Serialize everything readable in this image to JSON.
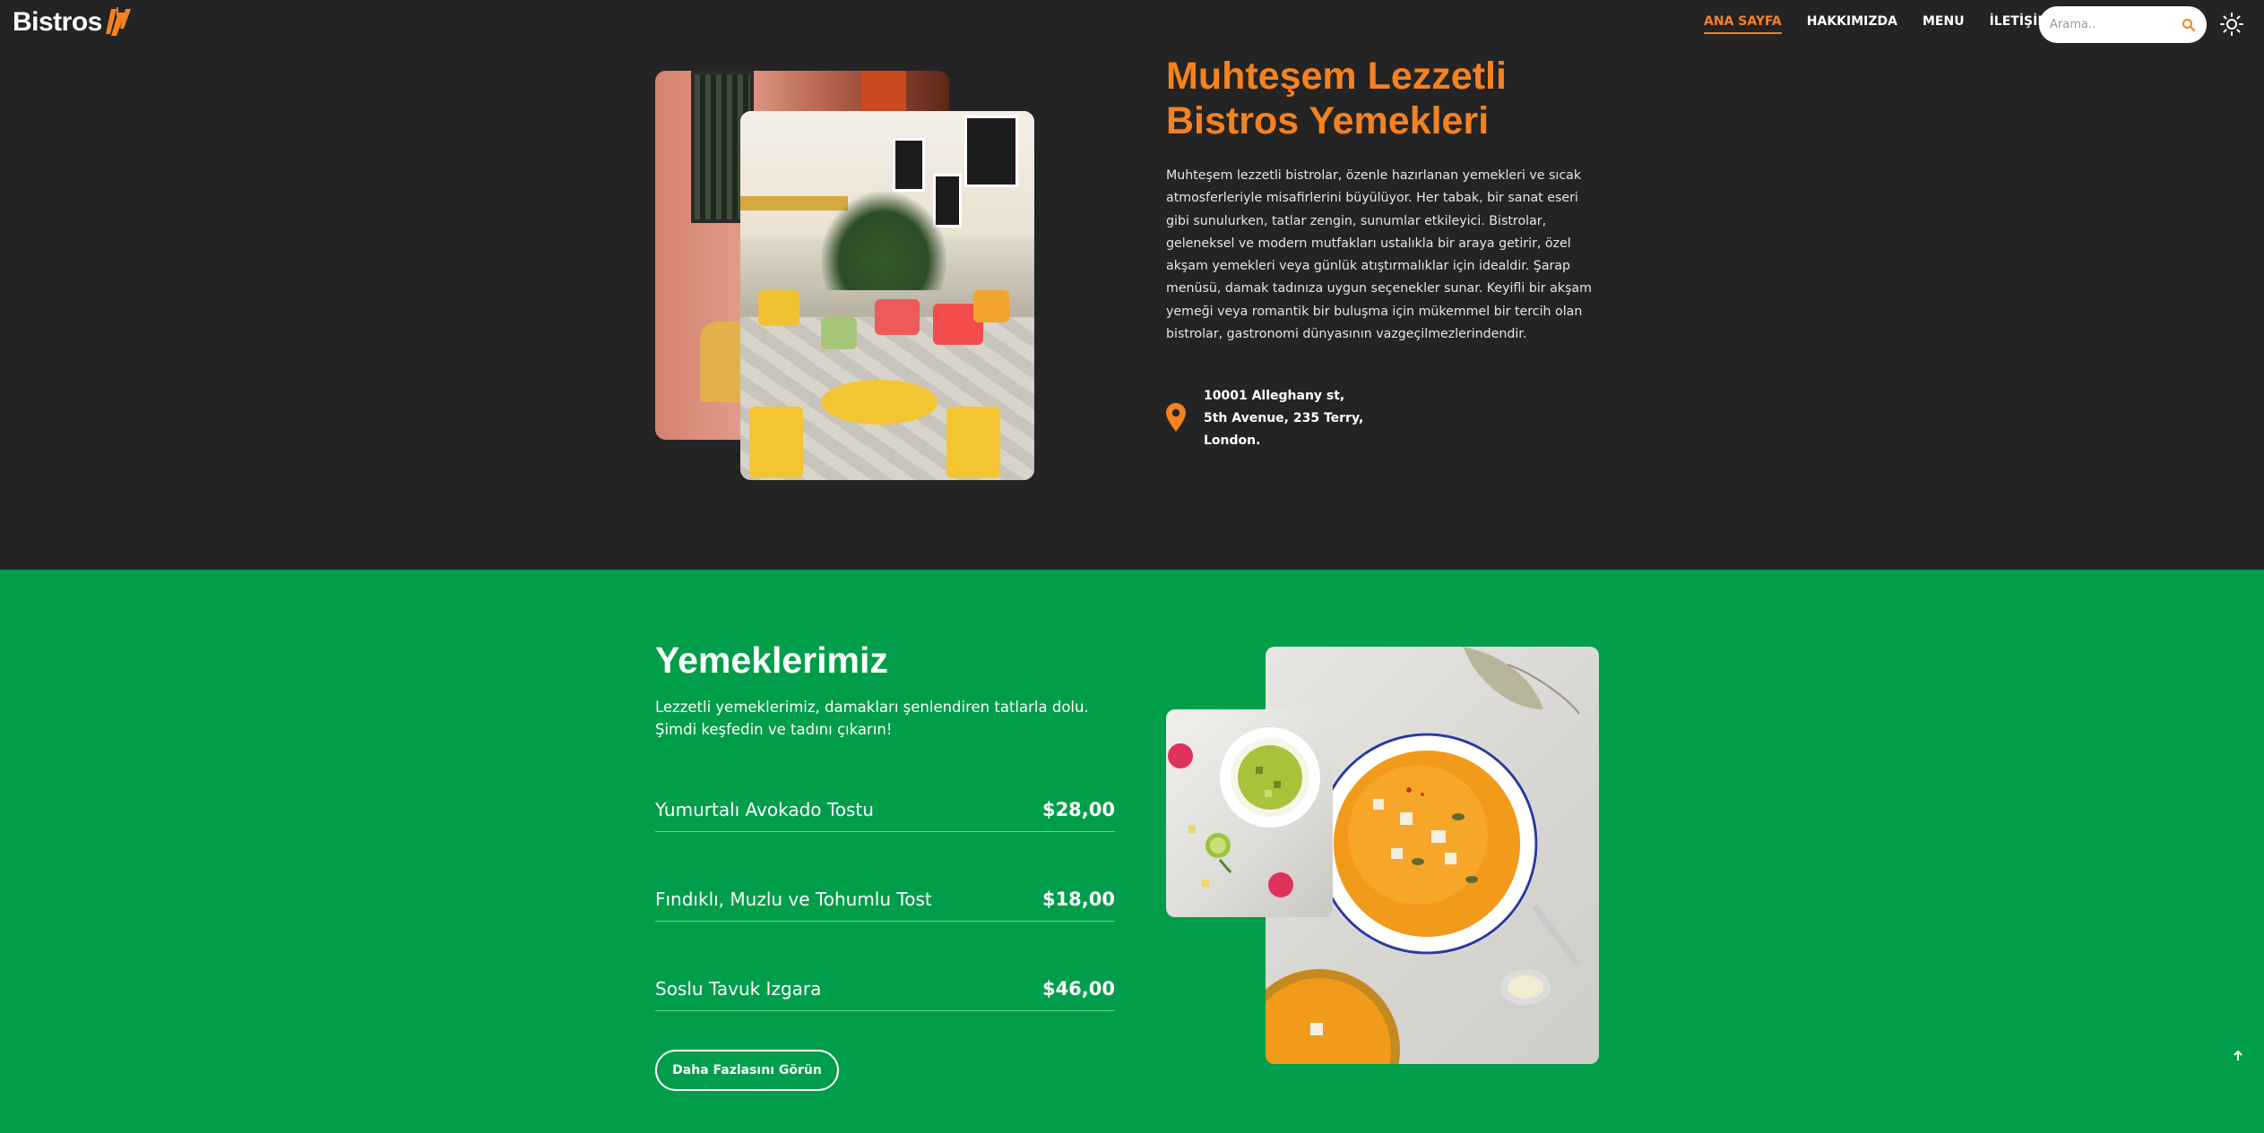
{
  "brand": {
    "name": "Bistros",
    "accent": "#f58220",
    "menu_bg": "#009e4a",
    "hero_bg": "#242424"
  },
  "nav": {
    "links": [
      {
        "label": "ANA SAYFA",
        "active": true
      },
      {
        "label": "HAKKIMIZDA",
        "active": false
      },
      {
        "label": "MENU",
        "active": false
      },
      {
        "label": "İLETİŞİM",
        "active": false
      }
    ],
    "search_placeholder": "Arama..",
    "icons": {
      "search": "search-icon",
      "theme": "sun-icon"
    }
  },
  "hero": {
    "title_line1": "Muhteşem Lezzetli",
    "title_line2": "Bistros Yemekleri",
    "description": "Muhteşem lezzetli bistrolar, özenle hazırlanan yemekleri ve sıcak atmosferleriyle misafirlerini büyülüyor. Her tabak, bir sanat eseri gibi sunulurken, tatlar zengin, sunumlar etkileyici. Bistrolar, geleneksel ve modern mutfakları ustalıkla bir araya getirir, özel akşam yemekleri veya günlük atıştırmalıklar için idealdir. Şarap menüsü, damak tadınıza uygun seçenekler sunar. Keyifli bir akşam yemeği veya romantik bir buluşma için mükemmel bir tercih olan bistrolar, gastronomi dünyasının vazgeçilmezlerindendir.",
    "address_line1": "10001 Alleghany st,",
    "address_line2": "5th Avenue, 235 Terry,",
    "address_line3": "London."
  },
  "menu": {
    "title": "Yemeklerimiz",
    "subtitle": "Lezzetli yemeklerimiz, damakları şenlendiren tatlarla dolu. Şimdi keşfedin ve tadını çıkarın!",
    "items": [
      {
        "name": "Yumurtalı Avokado Tostu",
        "price": "$28,00"
      },
      {
        "name": "Fındıklı, Muzlu ve Tohumlu Tost",
        "price": "$18,00"
      },
      {
        "name": "Soslu Tavuk Izgara",
        "price": "$46,00"
      }
    ],
    "more_label": "Daha Fazlasını Görün"
  }
}
